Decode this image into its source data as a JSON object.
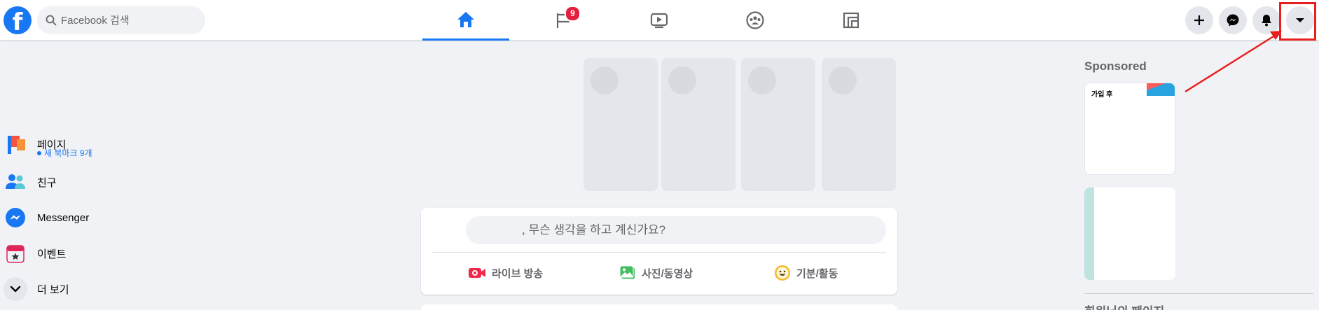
{
  "search": {
    "placeholder": "Facebook 검색"
  },
  "logo": {
    "letter": "f"
  },
  "nav": {
    "tabs": [
      {
        "name": "home",
        "active": true
      },
      {
        "name": "pages",
        "badge": "9"
      },
      {
        "name": "watch"
      },
      {
        "name": "groups"
      },
      {
        "name": "gaming"
      }
    ]
  },
  "sidebar": {
    "items": [
      {
        "label": "페이지",
        "icon": "flag-icon",
        "sub": "새 북마크 9개"
      },
      {
        "label": "친구",
        "icon": "friends-icon"
      },
      {
        "label": "Messenger",
        "icon": "messenger-icon"
      },
      {
        "label": "이벤트",
        "icon": "calendar-star-icon"
      },
      {
        "label": "더 보기",
        "icon": "chevron-down-icon"
      }
    ]
  },
  "composer": {
    "prompt": ", 무슨 생각을 하고 계신가요?",
    "actions": [
      {
        "label": "라이브 방송",
        "icon": "live-video-icon"
      },
      {
        "label": "사진/동영상",
        "icon": "photo-icon"
      },
      {
        "label": "기분/활동",
        "icon": "smiley-icon"
      }
    ]
  },
  "right": {
    "sponsored_title": "Sponsored",
    "ad1_text": "가입 후",
    "next_heading": "회원님의 페이지"
  },
  "colors": {
    "brand": "#1877f2",
    "badge": "#e41e3f",
    "annotation": "#e81f1f"
  }
}
